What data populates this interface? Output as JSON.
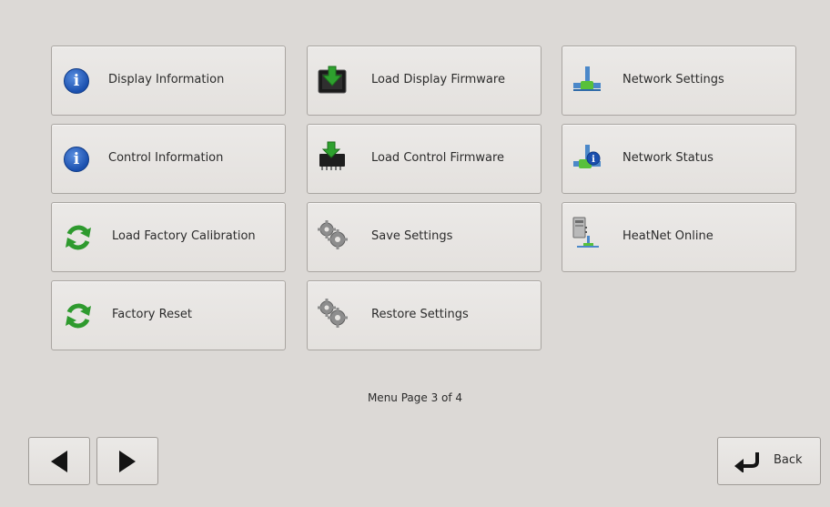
{
  "menu": {
    "tiles": [
      {
        "label": "Display Information",
        "icon": "info-icon"
      },
      {
        "label": "Load Display Firmware",
        "icon": "display-download-icon"
      },
      {
        "label": "Network Settings",
        "icon": "network-icon"
      },
      {
        "label": "Control Information",
        "icon": "info-icon"
      },
      {
        "label": "Load Control Firmware",
        "icon": "chip-download-icon"
      },
      {
        "label": "Network Status",
        "icon": "network-status-icon"
      },
      {
        "label": "Load Factory Calibration",
        "icon": "refresh-icon"
      },
      {
        "label": "Save Settings",
        "icon": "gears-icon"
      },
      {
        "label": "HeatNet Online",
        "icon": "server-network-icon"
      },
      {
        "label": "Factory Reset",
        "icon": "refresh-icon"
      },
      {
        "label": "Restore Settings",
        "icon": "gears-icon"
      }
    ]
  },
  "pager": {
    "label": "Menu Page 3 of 4"
  },
  "nav": {
    "back_label": "Back"
  },
  "colors": {
    "background": "#dcd9d6",
    "accent_green": "#2e9a2e",
    "info_blue": "#1a4fae"
  }
}
